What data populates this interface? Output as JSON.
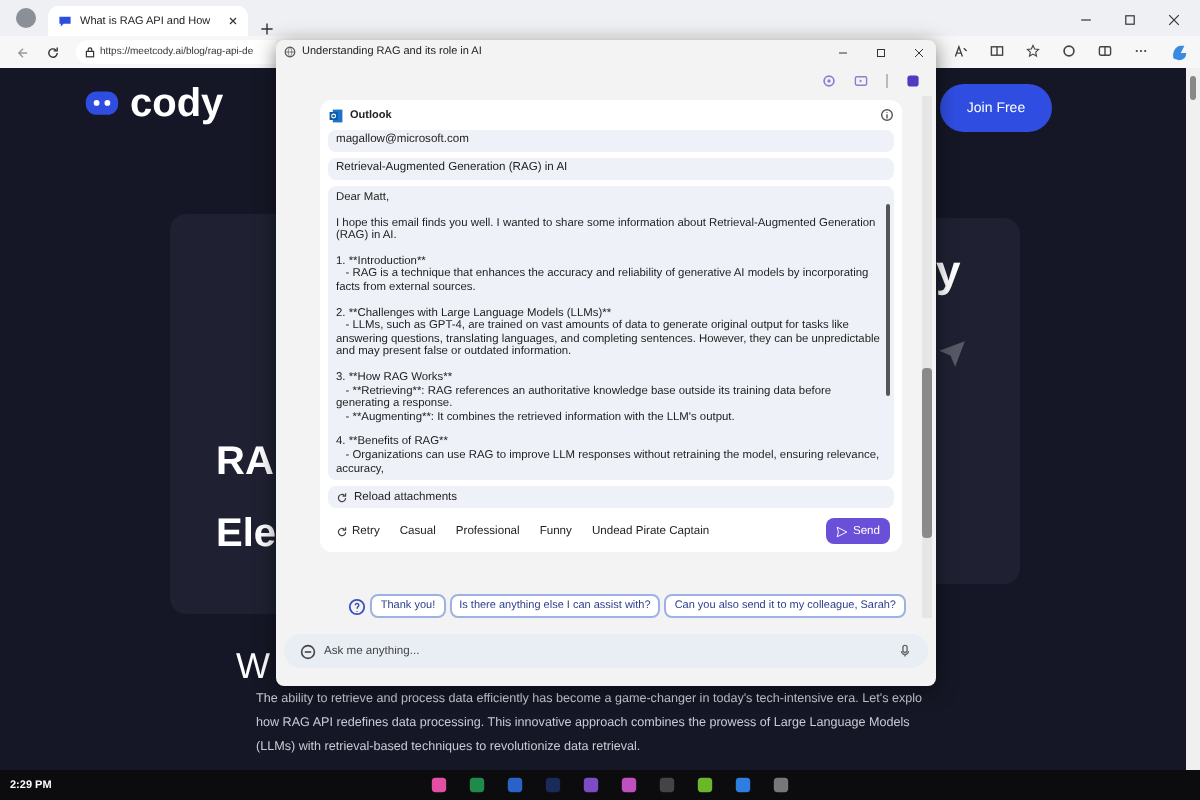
{
  "browser": {
    "tab_title": "What is RAG API and How",
    "url": "https://meetcody.ai/blog/rag-api-de"
  },
  "page": {
    "logo": "cody",
    "join_button": "Join Free",
    "hero_left": [
      "RA",
      "Ele"
    ],
    "hero_right": "y",
    "heading": "W",
    "paragraph_lines": [
      "The ability to retrieve and process data efficiently has become a game-changer in today's tech-intensive era. Let's explo",
      "how RAG API redefines data processing. This innovative approach combines the prowess of Large Language Models",
      "(LLMs) with retrieval-based techniques to revolutionize data retrieval."
    ]
  },
  "copilot": {
    "title": "Understanding RAG and its role in AI",
    "compose": {
      "app": "Outlook",
      "to": "magallow@microsoft.com",
      "subject": "Retrieval-Augmented Generation (RAG) in AI",
      "body": [
        "Dear Matt,",
        "I hope this email finds you well. I wanted to share some information about Retrieval-Augmented Generation (RAG) in AI.",
        "1. **Introduction**\n   - RAG is a technique that enhances the accuracy and reliability of generative AI models by incorporating facts from external sources.",
        "2. **Challenges with Large Language Models (LLMs)**\n   - LLMs, such as GPT-4, are trained on vast amounts of data to generate original output for tasks like answering questions, translating languages, and completing sentences. However, they can be unpredictable and may present false or outdated information.",
        "3. **How RAG Works**\n   - **Retrieving**: RAG references an authoritative knowledge base outside its training data before generating a response.\n   - **Augmenting**: It combines the retrieved information with the LLM's output.",
        "4. **Benefits of RAG**\n   - Organizations can use RAG to improve LLM responses without retraining the model, ensuring relevance, accuracy,"
      ],
      "reload": "Reload attachments",
      "tones": [
        {
          "kind": "retry",
          "label": "Retry"
        },
        {
          "kind": "tone",
          "label": "Casual"
        },
        {
          "kind": "tone",
          "label": "Professional"
        },
        {
          "kind": "tone",
          "label": "Funny"
        },
        {
          "kind": "tone",
          "label": "Undead Pirate Captain"
        }
      ],
      "send": "Send"
    },
    "suggestions": [
      "Thank you!",
      "Is there anything else I can assist with?",
      "Can you also send it to my colleague, Sarah?"
    ],
    "input": {
      "placeholder": "Ask me anything..."
    }
  },
  "taskbar": {
    "time": "2:29 PM"
  }
}
